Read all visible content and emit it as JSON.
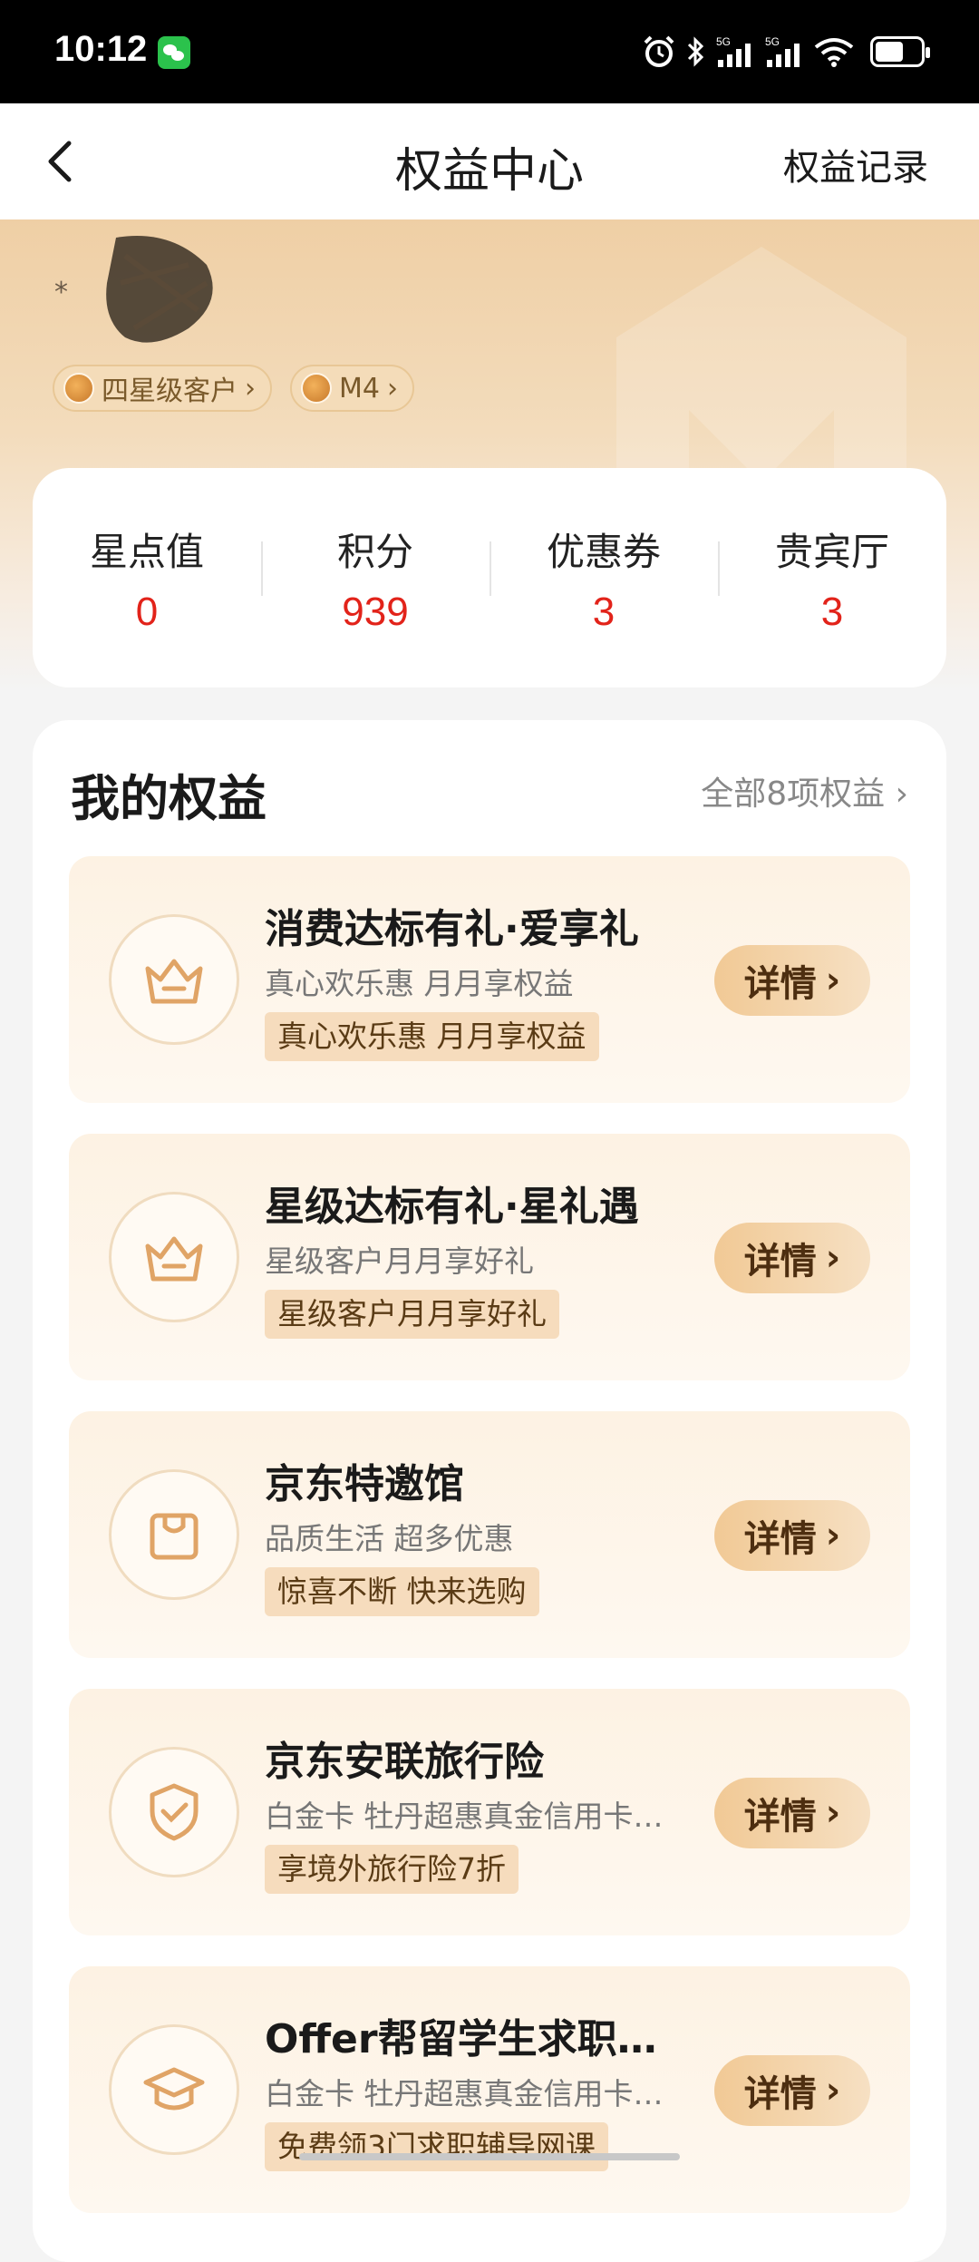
{
  "status_bar": {
    "time": "10:12",
    "signal1": "5G",
    "signal2": "5G"
  },
  "nav": {
    "title": "权益中心",
    "right": "权益记录"
  },
  "hero": {
    "tags": [
      {
        "label": "四星级客户"
      },
      {
        "label": "M4"
      }
    ]
  },
  "stats": [
    {
      "label": "星点值",
      "value": "0"
    },
    {
      "label": "积分",
      "value": "939"
    },
    {
      "label": "优惠券",
      "value": "3"
    },
    {
      "label": "贵宾厅",
      "value": "3"
    }
  ],
  "benefits": {
    "title": "我的权益",
    "all": "全部8项权益",
    "button_label": "详情",
    "items": [
      {
        "title": "消费达标有礼·爱享礼",
        "sub": "真心欢乐惠 月月享权益",
        "tag": "真心欢乐惠 月月享权益",
        "icon": "crown-basket-icon"
      },
      {
        "title": "星级达标有礼·星礼遇",
        "sub": "星级客户月月享好礼",
        "tag": "星级客户月月享好礼",
        "icon": "crown-basket-icon"
      },
      {
        "title": "京东特邀馆",
        "sub": "品质生活 超多优惠",
        "tag": "惊喜不断 快来选购",
        "icon": "shopping-bag-icon"
      },
      {
        "title": "京东安联旅行险",
        "sub": "白金卡 牡丹超惠真金信用卡…",
        "tag": "享境外旅行险7折",
        "icon": "shield-check-icon"
      },
      {
        "title": "Offer帮留学生求职…",
        "sub": "白金卡 牡丹超惠真金信用卡…",
        "tag": "免费领3门求职辅导网课",
        "icon": "graduation-cap-icon"
      }
    ]
  }
}
